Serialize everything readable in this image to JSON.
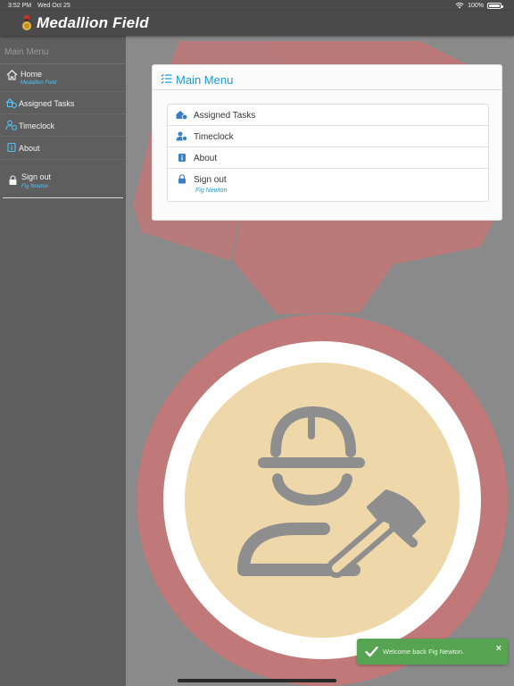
{
  "status_bar": {
    "time": "3:52 PM",
    "date": "Wed Oct 25",
    "battery": "100%"
  },
  "app": {
    "title": "Medallion Field",
    "logo_icon": "medallion-logo-icon"
  },
  "sidebar": {
    "header": "Main Menu",
    "items": [
      {
        "label": "Home",
        "sublabel": "Medallion Field",
        "icon": "home-icon"
      },
      {
        "label": "Assigned Tasks",
        "icon": "tasks-icon"
      },
      {
        "label": "Timeclock",
        "icon": "timeclock-icon"
      },
      {
        "label": "About",
        "icon": "info-icon"
      },
      {
        "label": "Sign out",
        "sublabel": "Fig Newton",
        "icon": "lock-icon"
      }
    ]
  },
  "card": {
    "title": "Main Menu",
    "title_icon": "checklist-icon",
    "items": [
      {
        "label": "Assigned Tasks",
        "icon": "tasks-icon"
      },
      {
        "label": "Timeclock",
        "icon": "timeclock-icon"
      },
      {
        "label": "About",
        "icon": "info-icon"
      },
      {
        "label": "Sign out",
        "sublabel": "Fig Newton",
        "icon": "lock-icon"
      }
    ]
  },
  "toast": {
    "message": "Welcome back Fig Newton.",
    "close": "×",
    "icon": "check-icon"
  },
  "colors": {
    "accent": "#1a9ad6",
    "sidebar_sublabel": "#4fc3f7",
    "toast_bg": "#56a352",
    "bar_bg": "#4a4a4a",
    "sidebar_bg": "#5e5e5e",
    "logo_red": "#c07878",
    "logo_tan": "#eed7a8"
  }
}
